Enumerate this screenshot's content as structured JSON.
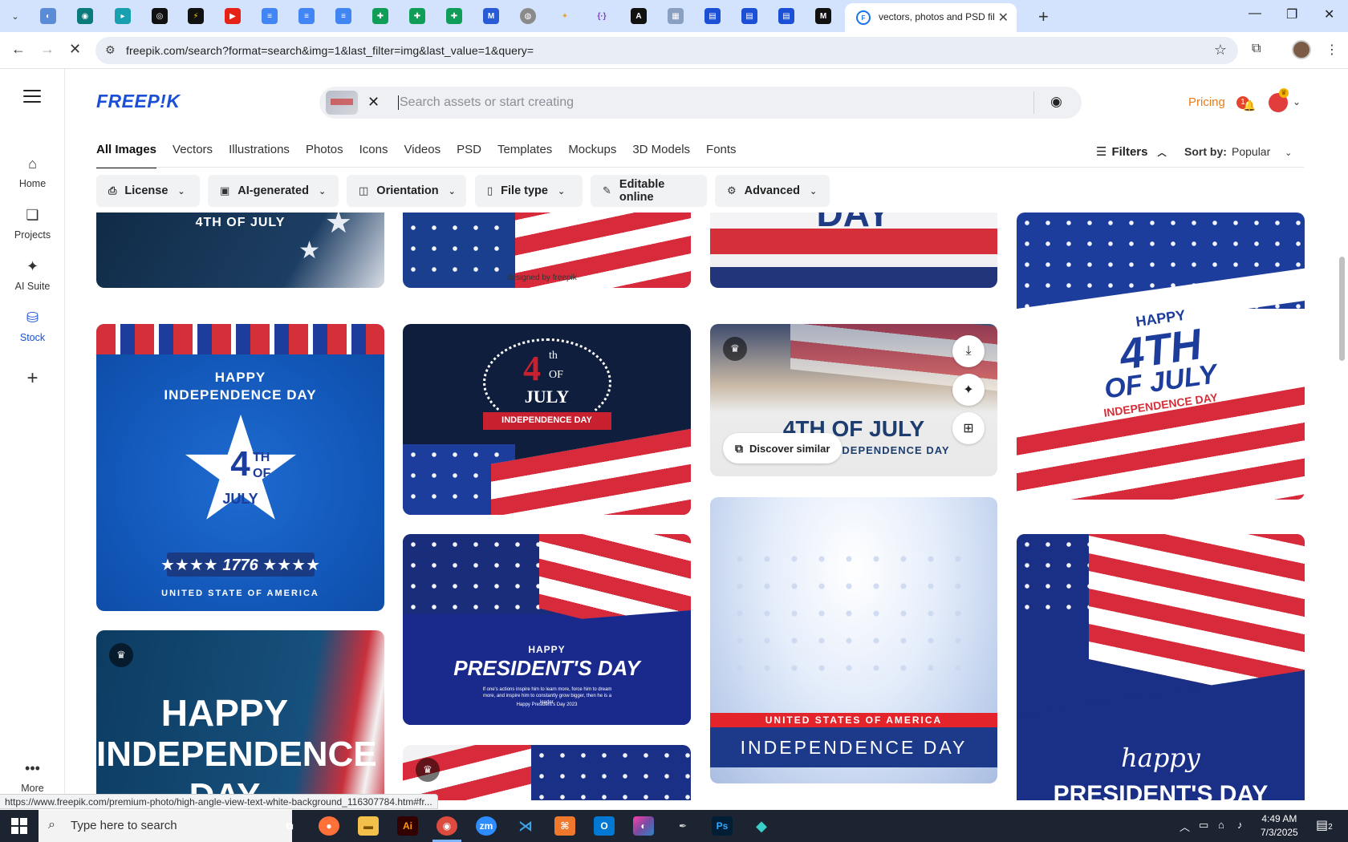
{
  "browser": {
    "active_tab_title": "vectors, photos and PSD files | F",
    "url": "freepik.com/search?format=search&img=1&last_filter=img&last_value=1&query=",
    "status_url": "https://www.freepik.com/premium-photo/high-angle-view-text-white-background_116307784.htm#fr..."
  },
  "rail": {
    "items": [
      {
        "label": "Home",
        "icon": "home-icon"
      },
      {
        "label": "Projects",
        "icon": "folder-icon"
      },
      {
        "label": "AI Suite",
        "icon": "sparkle-icon"
      },
      {
        "label": "Stock",
        "icon": "stock-icon"
      },
      {
        "label": "More",
        "icon": "more-icon"
      }
    ]
  },
  "header": {
    "logo": "FREEP!K",
    "search_placeholder": "Search assets or start creating",
    "pricing": "Pricing",
    "notification_count": "1"
  },
  "categories": [
    "All Images",
    "Vectors",
    "Illustrations",
    "Photos",
    "Icons",
    "Videos",
    "PSD",
    "Templates",
    "Mockups",
    "3D Models",
    "Fonts"
  ],
  "controls": {
    "filters_label": "Filters",
    "sort_label": "Sort by:",
    "sort_value": "Popular"
  },
  "filters": [
    "License",
    "AI-generated",
    "Orientation",
    "File type",
    "Editable online",
    "Advanced"
  ],
  "cards": {
    "c1_text": "4TH OF JULY",
    "c2_watermark": "designed by freepik",
    "c3_text": "DAY",
    "c4_line1": "HAPPY",
    "c4_line2": "4TH",
    "c4_line3": "OF JULY",
    "c4_line4": "INDEPENDENCE DAY",
    "c5_line1": "HAPPY",
    "c5_line2": "INDEPENDENCE DAY",
    "c5_star1": "4",
    "c5_star2": "TH",
    "c5_star3": "OF",
    "c5_star4": "JULY",
    "c5_year": "★★★★ 1776 ★★★★",
    "c5_footer": "UNITED STATE OF AMERICA",
    "c6_num": "4",
    "c6_th": "th",
    "c6_of": "OF",
    "c6_july": "JULY",
    "c6_banner": "INDEPENDENCE DAY",
    "c7_line1": "4TH OF JULY",
    "c7_line2": "INDEPENDENCE DAY",
    "discover_label": "Discover similar",
    "c8_line1": "HAPPY",
    "c8_line2": "PRESIDENT'S DAY",
    "c8_small": "If one's actions inspire him to learn more, force him to dream more, and inspire him to constantly grow bigger, then he is a leader.",
    "c8_tag": "Happy President's Day 2023",
    "c9_line1": "UNITED STATES OF AMERICA",
    "c9_line2": "INDEPENDENCE DAY",
    "c10_line1": "happy",
    "c10_line2": "PRESIDENT'S DAY",
    "c11_line1": "HAPPY",
    "c11_line2": "INDEPENDENCE",
    "c11_line3": "DAY"
  },
  "taskbar": {
    "search_placeholder": "Type here to search",
    "time": "4:49 AM",
    "date": "7/3/2025",
    "notif_count": "2"
  }
}
